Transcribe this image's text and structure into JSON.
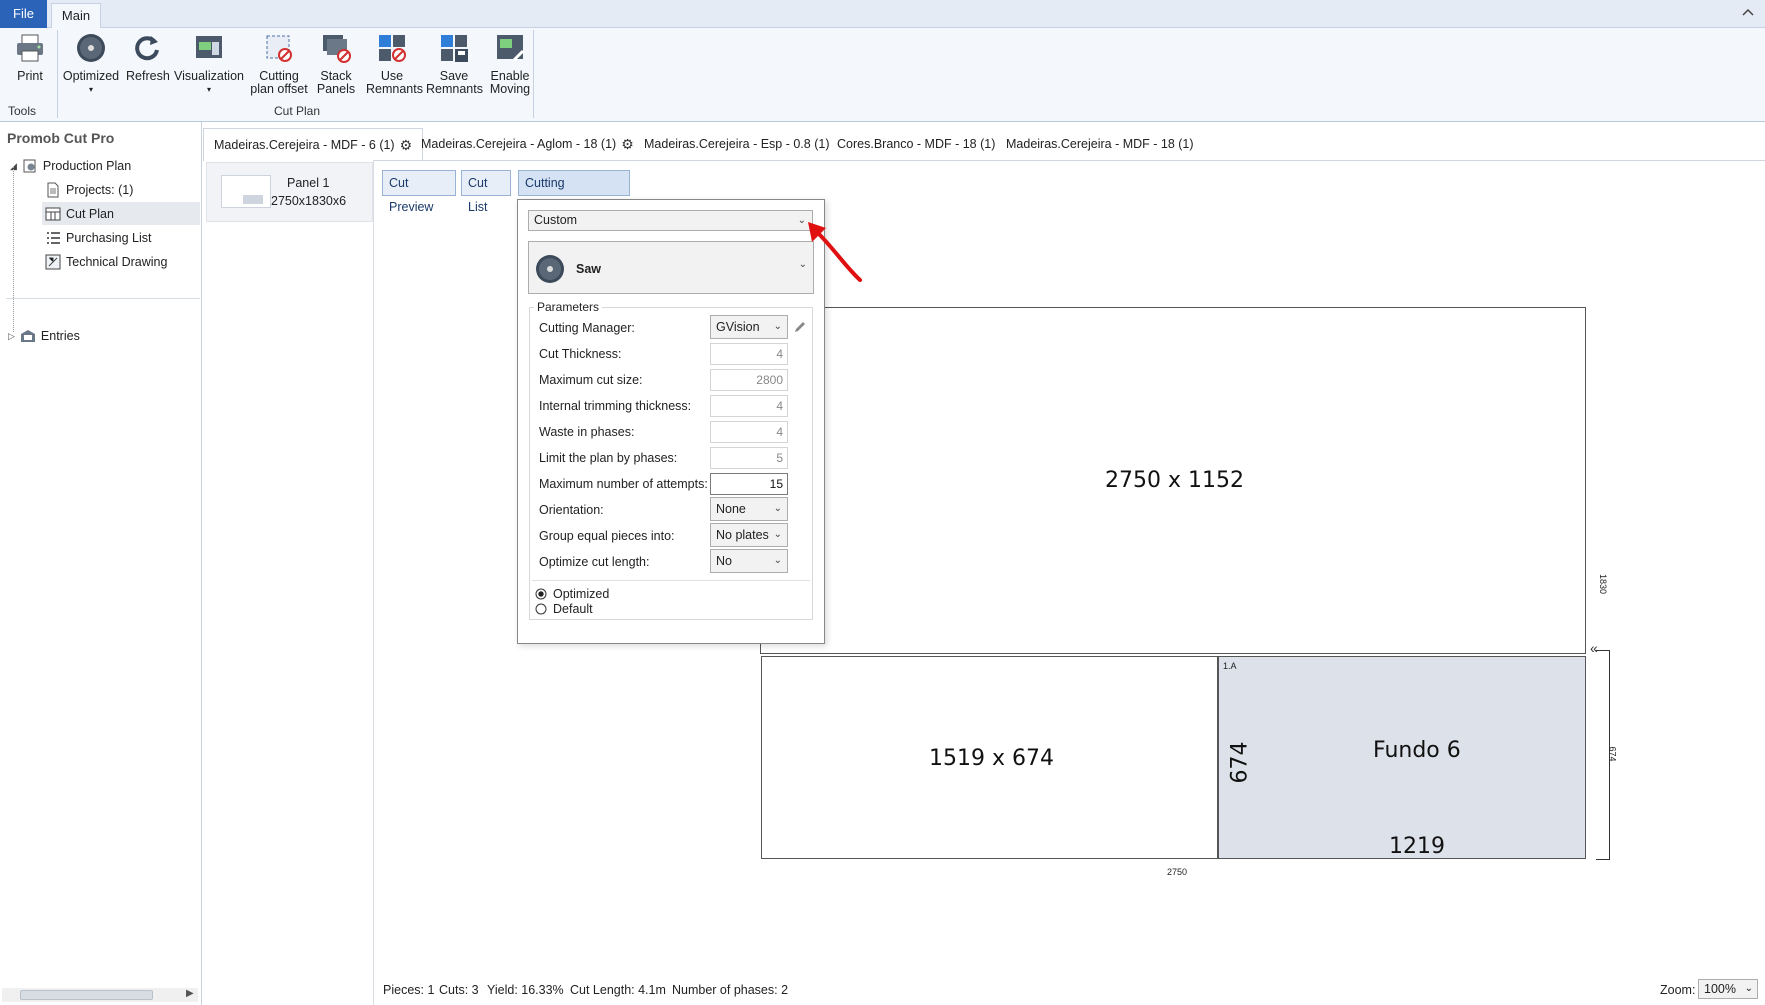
{
  "menu": {
    "file_label": "File",
    "main_tab_label": "Main"
  },
  "ribbon": {
    "tools": {
      "print_label": "Print",
      "group_label": "Tools"
    },
    "cutplan": {
      "optimized_label": "Optimized",
      "refresh_label": "Refresh",
      "visualization_label": "Visualization",
      "cutting_offset_label_1": "Cutting",
      "cutting_offset_label_2": "plan offset",
      "stack_label_1": "Stack",
      "stack_label_2": "Panels",
      "use_remnants_label_1": "Use",
      "use_remnants_label_2": "Remnants",
      "save_remnants_label_1": "Save",
      "save_remnants_label_2": "Remnants",
      "enable_moving_label_1": "Enable",
      "enable_moving_label_2": "Moving",
      "group_label": "Cut Plan"
    }
  },
  "sidebar": {
    "title": "Promob Cut Pro",
    "items": [
      {
        "label": "Production Plan"
      },
      {
        "label": "Projects: (1)"
      },
      {
        "label": "Cut Plan"
      },
      {
        "label": "Purchasing List"
      },
      {
        "label": "Technical Drawing"
      },
      {
        "label": "Entries"
      }
    ]
  },
  "doc_tabs": [
    {
      "label": "Madeiras.Cerejeira - MDF - 6 (1)"
    },
    {
      "label": "Madeiras.Cerejeira - Aglom - 18 (1)"
    },
    {
      "label": "Madeiras.Cerejeira - Esp - 0.8 (1)"
    },
    {
      "label": "Cores.Branco - MDF - 18 (1)"
    },
    {
      "label": "Madeiras.Cerejeira - MDF - 18 (1)"
    }
  ],
  "panel_list": [
    {
      "name": "Panel 1",
      "size": "2750x1830x6"
    }
  ],
  "view_tabs": {
    "preview": "Cut Preview",
    "list": "Cut List",
    "params": "Cutting Parameters"
  },
  "cutting_params": {
    "preset": "Custom",
    "machine": "Saw",
    "group_title": "Parameters",
    "labels": {
      "manager": "Cutting Manager:",
      "thickness": "Cut Thickness:",
      "max_cut": "Maximum cut size:",
      "trimming": "Internal trimming thickness:",
      "waste": "Waste in phases:",
      "limit_phases": "Limit the plan by phases:",
      "attempts": "Maximum number of attempts:",
      "orientation": "Orientation:",
      "group_equal": "Group equal pieces into:",
      "optimize_length": "Optimize cut length:"
    },
    "values": {
      "manager": "GVision",
      "thickness": "4",
      "max_cut": "2800",
      "trimming": "4",
      "waste": "4",
      "limit_phases": "5",
      "attempts": "15",
      "orientation": "None",
      "group_equal": "No plates",
      "optimize_length": "No"
    },
    "radio": {
      "optimized": "Optimized",
      "default": "Default",
      "selected": "Optimized"
    }
  },
  "drawing": {
    "top_piece": "2750 x 1152",
    "bottom_left": "1519 x 674",
    "piece_id": "1.A",
    "piece_name": "Fundo 6",
    "piece_width": "1219",
    "piece_height": "674",
    "dim_total_height": "1830",
    "dim_lower_height": "674",
    "dim_total_width": "2750"
  },
  "status": {
    "pieces": "Pieces: 1",
    "cuts": "Cuts: 3",
    "yield": "Yield: 16.33%",
    "cut_length": "Cut Length: 4.1m",
    "phases": "Number of phases: 2",
    "zoom_label": "Zoom:",
    "zoom_value": "100%"
  },
  "colors": {
    "accent": "#2b63b8",
    "piece_fill": "#dde1ea",
    "annotation": "#e01010"
  }
}
